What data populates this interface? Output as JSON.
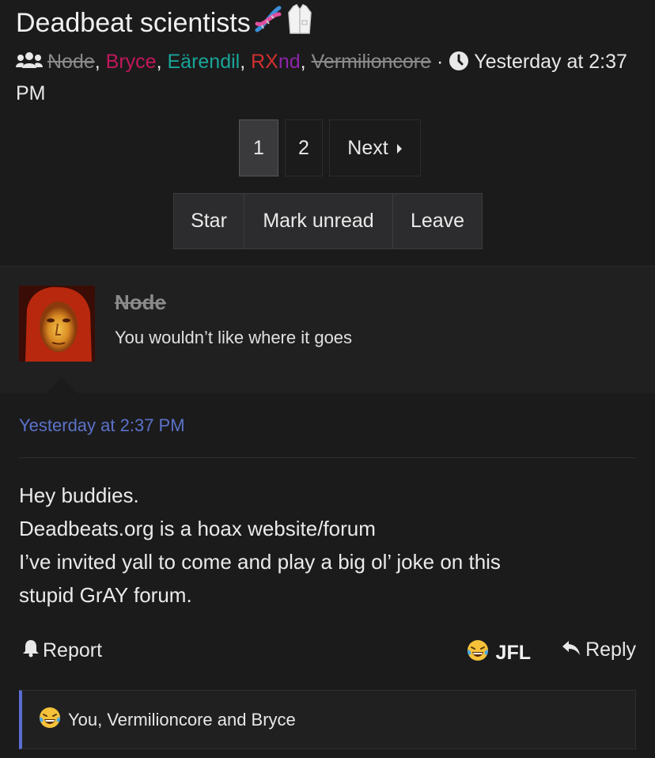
{
  "thread": {
    "title": "Deadbeat scientists",
    "title_emojis": [
      "dna-emoji",
      "lab-coat-emoji"
    ],
    "participants": [
      {
        "name": "Node",
        "style": "strike"
      },
      {
        "name": "Bryce",
        "color": "#c2185b"
      },
      {
        "name": "Eärendil",
        "color": "#19a598"
      },
      {
        "name": "RXnd",
        "color_r": "#d32f2f",
        "color_rest": "#8e24aa"
      },
      {
        "name": "Vermilioncore",
        "style": "strike"
      }
    ],
    "comma": ",",
    "dot": "·",
    "time_label": "Yesterday at 2:37 PM"
  },
  "pager": {
    "pages": [
      "1",
      "2"
    ],
    "active": "1",
    "next_label": "Next"
  },
  "actions": {
    "star": "Star",
    "mark_unread": "Mark unread",
    "leave": "Leave"
  },
  "post": {
    "author": "Node",
    "user_title": "You wouldn’t like where it goes",
    "timestamp": "Yesterday at 2:37 PM",
    "body_lines": [
      "Hey buddies.",
      "Deadbeats.org is a hoax website/forum",
      "I’ve invited yall to come and play a big ol’ joke on this",
      "stupid GrAY forum."
    ],
    "report_label": "Report",
    "reaction_label": "JFL",
    "reply_label": "Reply",
    "reactions_summary": "You, Vermilioncore and Bryce"
  },
  "colors": {
    "link_blue": "#5b72c9",
    "accent_bar": "#5b6ed1",
    "background": "#1b1b1c"
  }
}
